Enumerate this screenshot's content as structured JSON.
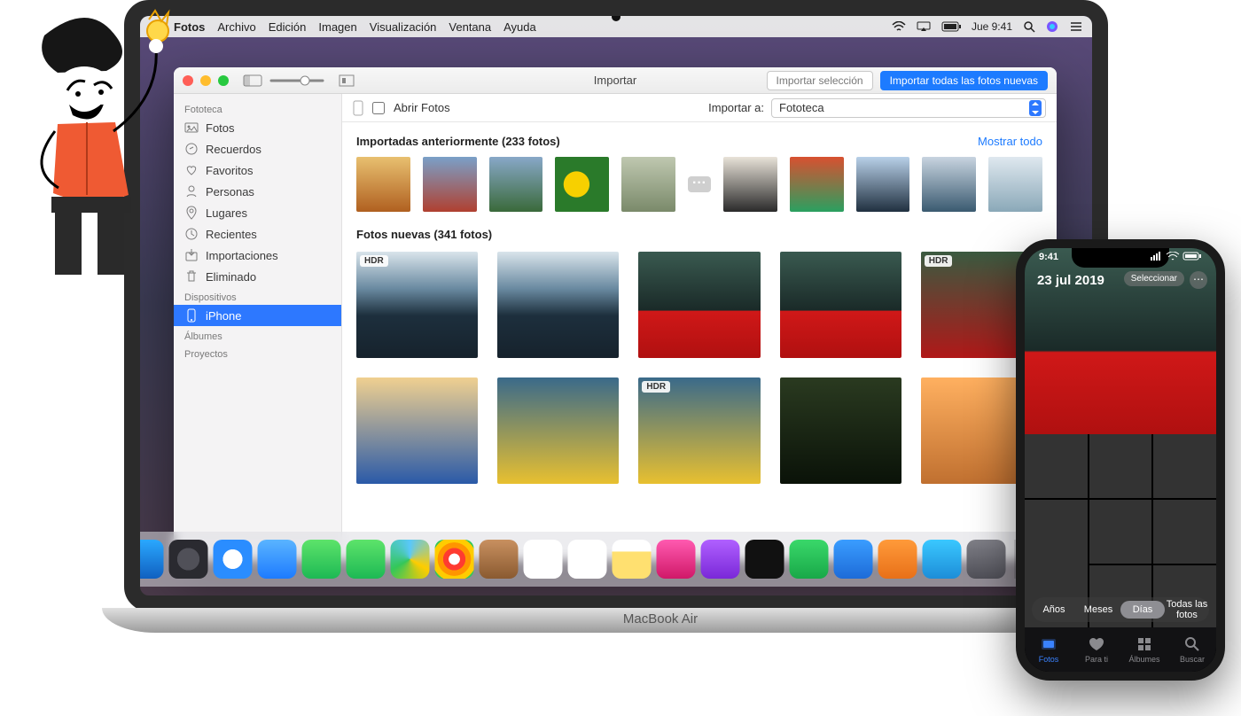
{
  "device_label": "MacBook Air",
  "menubar": {
    "app": "Fotos",
    "items": [
      "Archivo",
      "Edición",
      "Imagen",
      "Visualización",
      "Ventana",
      "Ayuda"
    ],
    "clock": "Jue 9:41"
  },
  "window": {
    "title": "Importar",
    "buttons": {
      "import_selection": "Importar selección",
      "import_all": "Importar todas las fotos nuevas"
    },
    "open_photos_label": "Abrir Fotos",
    "import_to_label": "Importar a:",
    "import_to_value": "Fototeca"
  },
  "sidebar": {
    "sections": {
      "library": "Fototeca",
      "devices": "Dispositivos",
      "albums": "Álbumes",
      "projects": "Proyectos"
    },
    "library_items": [
      "Fotos",
      "Recuerdos",
      "Favoritos",
      "Personas",
      "Lugares",
      "Recientes",
      "Importaciones",
      "Eliminado"
    ],
    "device_items": [
      "iPhone"
    ]
  },
  "sections": {
    "previous": {
      "title": "Importadas anteriormente (233 fotos)",
      "show_all": "Mostrar todo"
    },
    "new": {
      "title": "Fotos nuevas (341 fotos)"
    }
  },
  "hdr_label": "HDR",
  "iphone": {
    "time": "9:41",
    "date": "23 jul 2019",
    "select": "Seleccionar",
    "segs": [
      "Años",
      "Meses",
      "Días",
      "Todas las fotos"
    ],
    "seg_active": 2,
    "tabs": [
      "Fotos",
      "Para ti",
      "Álbumes",
      "Buscar"
    ]
  }
}
